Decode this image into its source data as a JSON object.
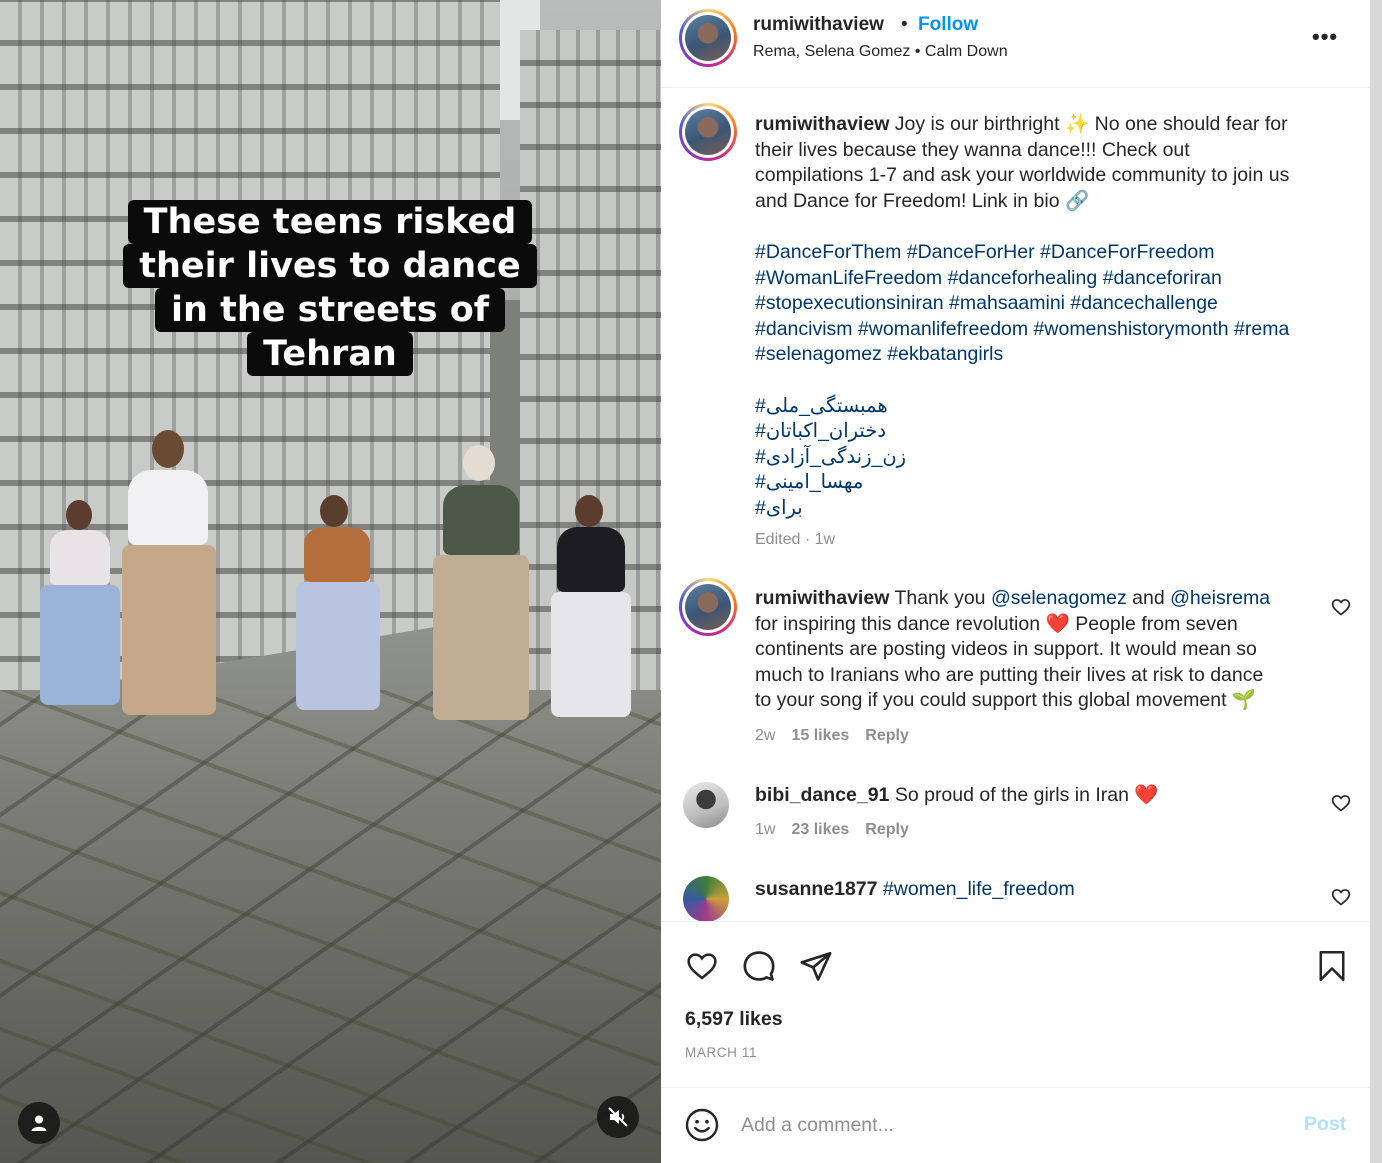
{
  "video": {
    "overlay_text": [
      "These teens risked",
      "their lives to dance",
      "in the streets of Tehran"
    ]
  },
  "header": {
    "username": "rumiwithaview",
    "separator": "•",
    "follow_label": "Follow",
    "audio": "Rema, Selena Gomez • Calm Down",
    "more_label": "•••"
  },
  "caption": {
    "username": "rumiwithaview",
    "text_lines": [
      "Joy is our birthright ✨ No one should fear for",
      "their lives because they wanna dance!!! Check out",
      "compilations 1-7 and ask your worldwide community to join us",
      "and Dance for Freedom! Link in bio 🔗"
    ],
    "hashtag_lines": [
      "#DanceForThem #DanceForHer #DanceForFreedom",
      "#WomanLifeFreedom #danceforhealing #danceforiran",
      "#stopexecutionsiniran #mahsaamini #dancechallenge",
      "#dancivism #womanlifefreedom #womenshistorymonth #rema",
      "#selenagomez #ekbatangirls"
    ],
    "persian_tags": [
      "#همبستگی_ملی",
      "#دختران_اکباتان",
      "#زن_زندگی_آزادی",
      "#مهسا_امینی",
      "#برای"
    ],
    "meta": "Edited · 1w"
  },
  "comments": [
    {
      "username": "rumiwithaview",
      "text_before": "Thank you",
      "mention1": "@selenagomez",
      "text_mid": "and",
      "mention2": "@heisrema",
      "lines": [
        "for inspiring this dance revolution ❤️ People from seven",
        "continents are posting videos in support. It would mean so",
        "much to Iranians who are putting their lives at risk to dance",
        "to your song if you could support this global movement 🌱"
      ],
      "time": "2w",
      "likes": "15 likes",
      "reply": "Reply"
    },
    {
      "username": "bibi_dance_91",
      "text": "So proud of the girls in Iran ❤️",
      "time": "1w",
      "likes": "23 likes",
      "reply": "Reply"
    },
    {
      "username": "susanne1877",
      "hashtag": "#women_life_freedom"
    }
  ],
  "actions": {
    "likes": "6,597 likes",
    "date": "MARCH 11"
  },
  "add_comment": {
    "placeholder": "Add a comment...",
    "post_label": "Post"
  },
  "colors": {
    "link_blue": "#0095f6",
    "hashtag": "#00376b",
    "muted": "#8e8e8e",
    "post_disabled": "#b2dffc",
    "heart_red": "#ed4956"
  }
}
